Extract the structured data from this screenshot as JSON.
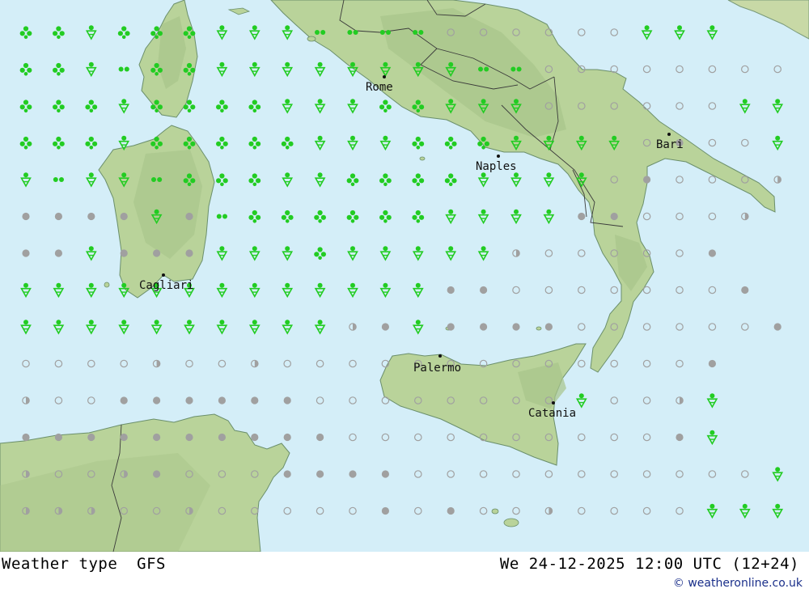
{
  "map": {
    "cities": [
      {
        "name": "Rome",
        "key": "rome"
      },
      {
        "name": "Naples",
        "key": "naples"
      },
      {
        "name": "Bari",
        "key": "bari"
      },
      {
        "name": "Cagliari",
        "key": "cagliari"
      },
      {
        "name": "Palermo",
        "key": "palermo"
      },
      {
        "name": "Catania",
        "key": "catania"
      }
    ],
    "symbol_legend": {
      "C": "cloud-grey-filled",
      "O": "clear-ring",
      "H": "half-cloud-ring",
      "S": "showers-green",
      "D": "drizzle-green",
      "T": "rain-pair-green",
      "R": "rain-arrow-green"
    },
    "colors": {
      "sea": "#d4eef8",
      "land": "#b9d39a",
      "rain_green": "#22cc22",
      "cloud_grey": "#a0a0a0"
    },
    "weather_grid": [
      "SSRSSSRRRTTTTOOOOOORRR",
      "SSRTSSRRRRRRRRTTOOOOOOOORRR",
      "SSSRSSSSRRRSSRRROOOOOORR",
      "SSSRSSSSSRRRSSSRRRROCOORR",
      "RTRRTSSSRRSSSSRRRROCOOOH",
      "CCCCRCTSSSSSSRRRRCCOOOH",
      "CCRCCCRRRSRRRRRHOOOOOC",
      "RRRRRRRRRRRRRCCOOOOOOOC",
      "RRRRRRRRRRHCRCCCCOOOOOOC",
      "OOOOHOOHOOOOOOOOOOOOOC",
      "HOOCCCCCCOOOOOOOOROOHR",
      "CCCCCCCCCCOOOOOOOOOOCR",
      "HOOHCOOOCCCCOOOOOOOOOOORR",
      "HHHOOHOOOOOCOCOOHOOOORRR"
    ]
  },
  "footer": {
    "title": "Weather type  GFS",
    "datetime": "We 24-12-2025 12:00 UTC (12+24)",
    "credit": "© weatheronline.co.uk"
  }
}
